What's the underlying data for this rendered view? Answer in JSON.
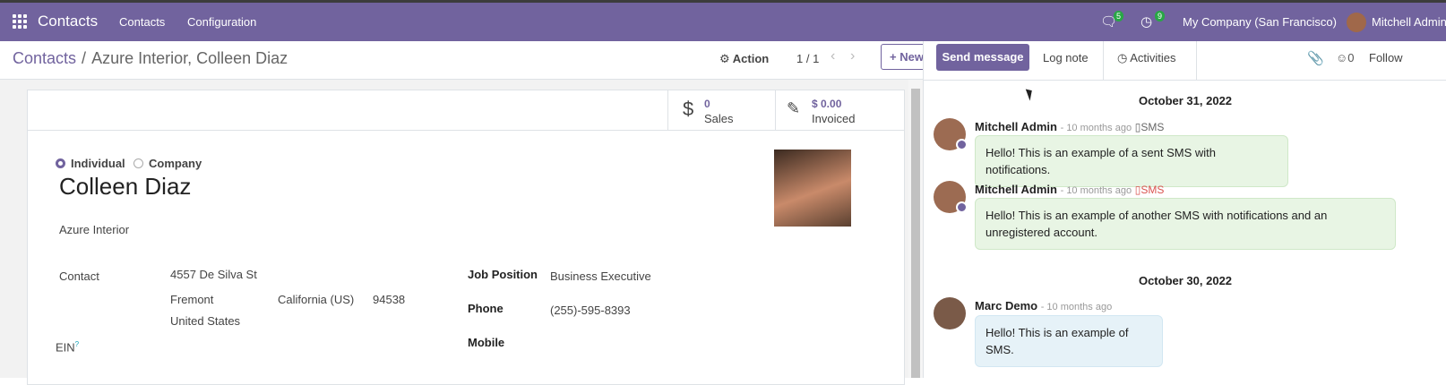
{
  "topbar": {
    "app_name": "Contacts",
    "menu": [
      "Contacts",
      "Configuration"
    ],
    "messages_count": "5",
    "activities_count": "9",
    "company": "My Company (San Francisco)",
    "user": "Mitchell Admin"
  },
  "breadcrumb": {
    "parent": "Contacts",
    "separator": "/",
    "current": "Azure Interior, Colleen Diaz"
  },
  "toolbar": {
    "action_label": "Action",
    "pager": "1 / 1",
    "new_label": "New"
  },
  "stats": [
    {
      "icon": "dollar-icon",
      "value": "0",
      "label": "Sales"
    },
    {
      "icon": "edit-icon",
      "value": "$ 0.00",
      "label": "Invoiced"
    }
  ],
  "form": {
    "type_options": [
      "Individual",
      "Company"
    ],
    "type_selected": "Individual",
    "name": "Colleen Diaz",
    "company_name": "Azure Interior",
    "contact_label": "Contact",
    "street": "4557 De Silva St",
    "city": "Fremont",
    "state": "California (US)",
    "zip": "94538",
    "country": "United States",
    "ein_label": "EIN",
    "ein_help": "?",
    "job_label": "Job Position",
    "job_value": "Business Executive",
    "phone_label": "Phone",
    "phone_value": "(255)-595-8393",
    "mobile_label": "Mobile"
  },
  "chatter": {
    "send_message": "Send message",
    "log_note": "Log note",
    "activities": "Activities",
    "followers_count": "0",
    "follow_label": "Follow",
    "groups": [
      {
        "date": "October 31, 2022",
        "messages": [
          {
            "author": "Mitchell Admin",
            "time": "- 10 months ago",
            "channel": "SMS",
            "channel_error": false,
            "body": "Hello! This is an example of a sent SMS with notifications."
          },
          {
            "author": "Mitchell Admin",
            "time": "- 10 months ago",
            "channel": "SMS",
            "channel_error": true,
            "body": "Hello! This is an example of another SMS with notifications and an unregistered account."
          }
        ]
      },
      {
        "date": "October 30, 2022",
        "messages": [
          {
            "author": "Marc Demo",
            "time": "- 10 months ago",
            "channel": "",
            "channel_error": false,
            "body": "Hello! This is an example of SMS."
          }
        ]
      }
    ]
  },
  "colors": {
    "brand": "#71639e",
    "sms_bubble": "#e8f5e4",
    "note_bubble": "#e6f2f8",
    "error": "#d9534f"
  }
}
